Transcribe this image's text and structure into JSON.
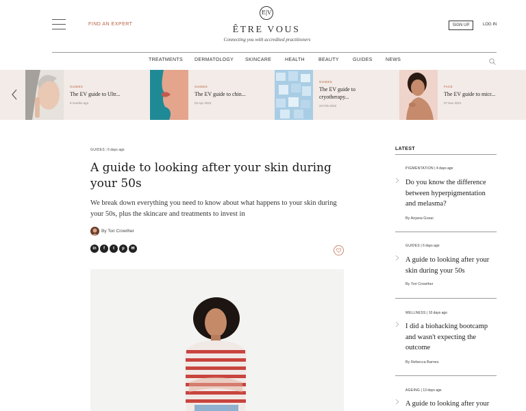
{
  "header": {
    "find_expert": "FIND AN EXPERT",
    "logo_mark": "E|V",
    "brand": "ÊTRE VOUS",
    "tagline": "Connecting you with accredited practitioners",
    "signup": "SIGN UP",
    "login": "LOG IN"
  },
  "nav": [
    "TREATMENTS",
    "DERMATOLOGY",
    "SKINCARE",
    "HEALTH",
    "BEAUTY",
    "GUIDES",
    "NEWS"
  ],
  "carousel": [
    {
      "tag": "GUIDES",
      "title": "The EV guide to Ultr...",
      "date": "8 months ago"
    },
    {
      "tag": "GUIDES",
      "title": "The EV guide to chin...",
      "date": "03 Apr 2022"
    },
    {
      "tag": "GUIDES",
      "title": "The EV guide to cryotherapy...",
      "date": "23 Feb 2022"
    },
    {
      "tag": "FACE",
      "title": "The EV guide to micr...",
      "date": "07 Nov 2021"
    }
  ],
  "article": {
    "category": "GUIDES",
    "age": "6 days ago",
    "headline": "A guide to looking after your skin during your 50s",
    "standfirst": "We break down everything you need to know about what happens to your skin during your 50s, plus the skincare and treatments to invest in",
    "author": "By Tori Crowther",
    "share": [
      "in",
      "f",
      "t",
      "p",
      "✉"
    ]
  },
  "sidebar": {
    "heading": "LATEST",
    "items": [
      {
        "category": "PIGMENTATION",
        "age": "4 days ago",
        "title": "Do you know the difference between hyperpigmentation and melasma?",
        "author": "By Anjana Gosai"
      },
      {
        "category": "GUIDES",
        "age": "6 days ago",
        "title": "A guide to looking after your skin during your 50s",
        "author": "By Tori Crowther"
      },
      {
        "category": "WELLNESS",
        "age": "10 days ago",
        "title": "I did a biohacking bootcamp and wasn't expecting the outcome",
        "author": "By Rebecca Barnes"
      },
      {
        "category": "AGEING",
        "age": "13 days ago",
        "title": "A guide to looking after your",
        "author": ""
      }
    ]
  },
  "colors": {
    "accent": "#b5603f",
    "carousel_bg": "#f3ebe7"
  }
}
